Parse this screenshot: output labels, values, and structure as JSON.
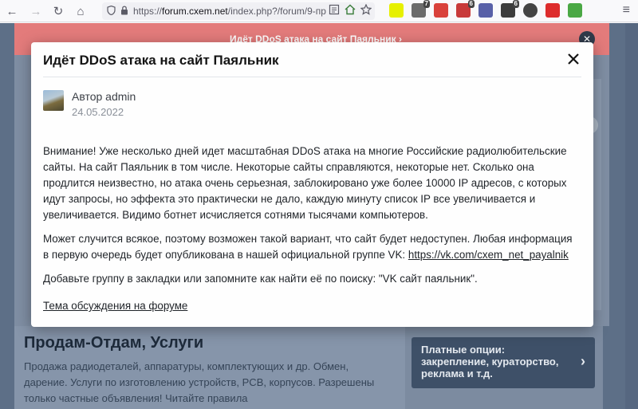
{
  "browser": {
    "url_prefix": "https://",
    "url_host": "forum.cxem.net",
    "url_path": "/index.php?/forum/9-пр",
    "nav": {
      "back": "←",
      "forward": "→",
      "reload": "↻",
      "home": "⌂"
    },
    "extensions": [
      {
        "name": "ext-1",
        "color": "#e6f000",
        "badge": ""
      },
      {
        "name": "ext-2",
        "color": "#6b6b6b",
        "badge": "7"
      },
      {
        "name": "ext-3",
        "color": "#d9413b",
        "badge": ""
      },
      {
        "name": "ext-4",
        "color": "#c83a3a",
        "badge": "6"
      },
      {
        "name": "ext-5",
        "color": "#5860a8",
        "badge": ""
      },
      {
        "name": "ext-6",
        "color": "#3c3c3c",
        "badge": "6"
      },
      {
        "name": "ext-7",
        "color": "#444444",
        "badge": ""
      },
      {
        "name": "ext-8",
        "color": "#dd2c2c",
        "badge": ""
      },
      {
        "name": "ext-9",
        "color": "#4aa844",
        "badge": ""
      }
    ],
    "menu_glyph": "≡"
  },
  "background": {
    "announce_text": "Идёт DDoS атака на сайт Паяльник  ›",
    "section_title": "Продам-Отдам, Услуги",
    "section_desc": "Продажа радиодеталей, аппаратуры, комплектующих и др. Обмен, дарение. Услуги по изготовлению устройств, PCB, корпусов. Разрешены только частные объявления! Читайте правила",
    "paid_options": "Платные опции: закрепление, кураторство, реклама и т.д.",
    "paid_chevron": "›"
  },
  "modal": {
    "title": "Идёт DDoS атака на сайт Паяльник",
    "author_label": "Автор admin",
    "date": "24.05.2022",
    "p1": "Внимание! Уже несколько дней идет масштабная DDoS атака на многие Российские радиолюбительские сайты. На сайт Паяльник в том числе. Некоторые сайты справляются, некоторые нет. Сколько она продлится неизвестно, но атака очень серьезная, заблокировано уже более 10000 IP адресов, с которых идут запросы, но эффекта это практически не дало, каждую минуту список IP все увеличивается и увеличивается. Видимо ботнет исчисляется сотнями тысячами компьютеров.",
    "p2_text": "Может случится всякое, поэтому возможен такой вариант, что сайт будет недоступен. Любая информация в первую очередь будет опубликована в нашей официальной группе VK: ",
    "p2_link": "https://vk.com/cxem_net_payalnik",
    "p3": "Добавьте группу в закладки или запомните как найти её по поиску: \"VK сайт паяльник\".",
    "footer_link": "Тема обсуждения на форуме"
  }
}
